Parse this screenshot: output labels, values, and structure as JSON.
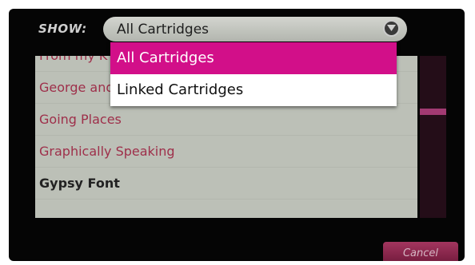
{
  "header": {
    "show_label": "SHOW:",
    "selected_value": "All Cartridges"
  },
  "dropdown": {
    "options": [
      "All Cartridges",
      "Linked Cartridges"
    ]
  },
  "list": {
    "items": [
      "From my K",
      "George and Basic Shapes®",
      "Going Places",
      "Graphically Speaking",
      "Gypsy Font"
    ]
  },
  "footer": {
    "cancel_label": "Cancel"
  },
  "icons": {
    "select_arrow": "chevron-down-icon"
  },
  "colors": {
    "accent": "#d20f89",
    "list_text": "#9e2f4a",
    "active_text": "#222222",
    "scroll_thumb": "#a23a72"
  }
}
